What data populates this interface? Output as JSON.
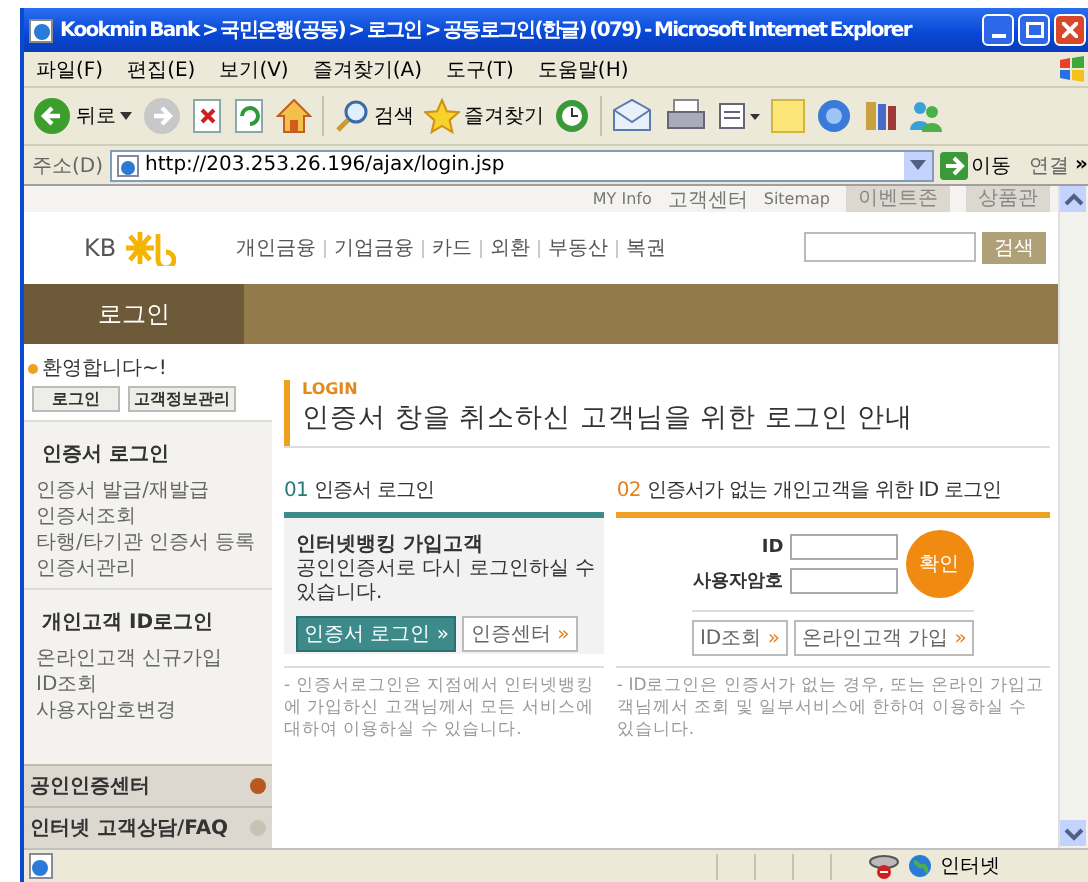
{
  "window": {
    "title": "Kookmin Bank > 국민은행(공동) > 로그인 > 공동로그인(한글) (079) - Microsoft Internet Explorer"
  },
  "menu": [
    "파일(F)",
    "편집(E)",
    "보기(V)",
    "즐겨찾기(A)",
    "도구(T)",
    "도움말(H)"
  ],
  "toolbar": {
    "back": "뒤로",
    "search": "검색",
    "favorites": "즐겨찾기"
  },
  "address": {
    "label": "주소(D)",
    "url": "http://203.253.26.196/ajax/login.jsp",
    "go": "이동",
    "links": "연결",
    "more": "»"
  },
  "page": {
    "util_links": [
      "MY Info",
      "고객센터",
      "Sitemap"
    ],
    "util_tabs": [
      "이벤트존",
      "상품관"
    ],
    "logo": "KB",
    "nav": [
      "개인금융",
      "기업금융",
      "카드",
      "외환",
      "부동산",
      "복권"
    ],
    "search_button": "검색",
    "page_title": "로그인"
  },
  "sidebar": {
    "welcome": "환영합니다~!",
    "buttons": [
      "로그인",
      "고객정보관리"
    ],
    "groups": [
      {
        "heading": "인증서 로그인",
        "links": [
          "인증서 발급/재발급",
          "인증서조회",
          "타행/타기관 인증서 등록",
          "인증서관리"
        ]
      },
      {
        "heading": "개인고객 ID로그인",
        "links": [
          "온라인고객 신규가입",
          "ID조회",
          "사용자암호변경"
        ]
      }
    ],
    "menus": [
      {
        "label": "공인인증센터",
        "color": "#b8581e"
      },
      {
        "label": "인터넷 고객상담/FAQ",
        "color": "#c9c2b4"
      }
    ]
  },
  "main": {
    "eyebrow": "LOGIN",
    "headline": "인증서 창을 취소하신 고객님을 위한 로그인 안내",
    "cert": {
      "number": "01",
      "title": "인증서 로그인",
      "bullet": "인터넷뱅킹 가입고객",
      "text": "공인인증서로 다시 로그인하실 수 있습니다.",
      "buttons": [
        {
          "label": "인증서 로그인",
          "arrow": "»",
          "kind": "primary"
        },
        {
          "label": "인증센터",
          "arrow": "»",
          "kind": "plain"
        }
      ],
      "note": "- 인증서로그인은 지점에서 인터넷뱅킹에 가입하신 고객님께서 모든 서비스에 대하여 이용하실 수 있습니다."
    },
    "id": {
      "number": "02",
      "title": "인증서가 없는 개인고객을 위한 ID 로그인",
      "id_label": "ID",
      "password_label": "사용자암호",
      "confirm": "확인",
      "buttons": [
        {
          "label": "ID조회",
          "arrow": "»",
          "kind": "plain"
        },
        {
          "label": "온라인고객 가입",
          "arrow": "»",
          "kind": "plain"
        }
      ],
      "note": "- ID로그인은 인증서가 없는 경우, 또는 온라인 가입고객님께서 조회 및 일부서비스에 한하여 이용하실 수 있습니다."
    }
  },
  "status_bar": {
    "zone": "인터넷"
  }
}
